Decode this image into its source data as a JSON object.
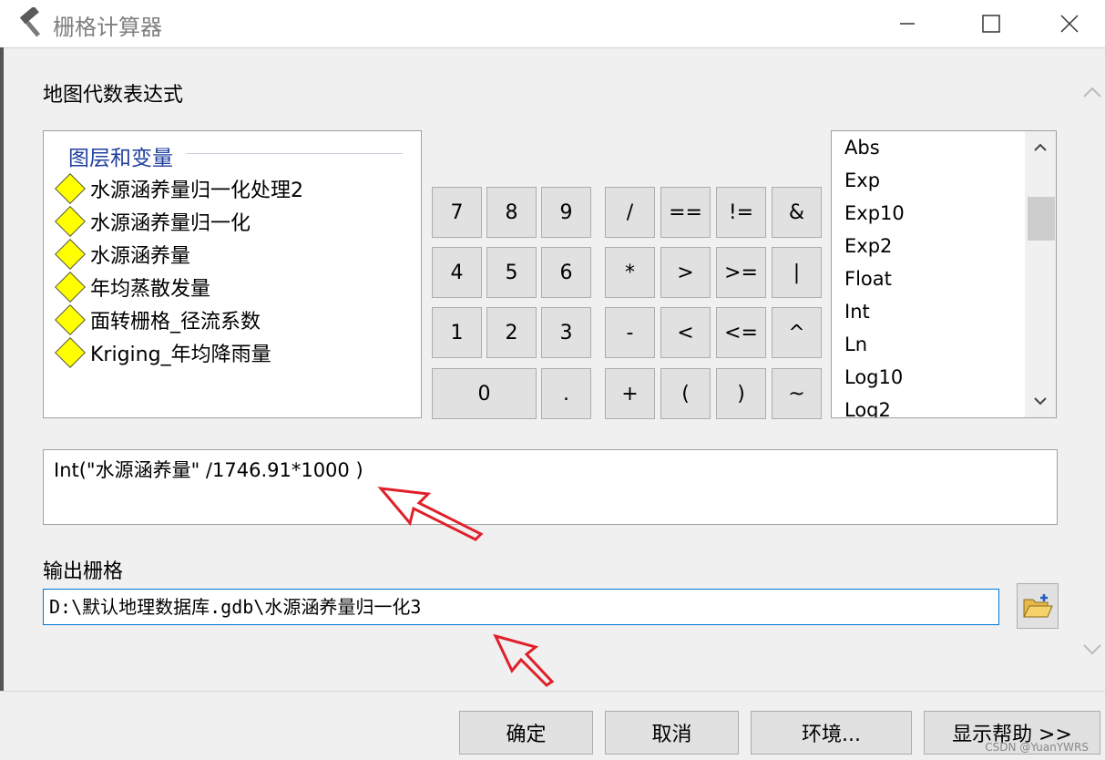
{
  "window": {
    "title": "栅格计算器",
    "minimize": "—",
    "maximize": "☐",
    "close": "✕"
  },
  "labels": {
    "map_algebra": "地图代数表达式",
    "output_raster": "输出栅格"
  },
  "layers": {
    "header": "图层和变量",
    "items": [
      "水源涵养量归一化处理2",
      "水源涵养量归一化",
      "水源涵养量",
      "年均蒸散发量",
      "面转栅格_径流系数",
      "Kriging_年均降雨量"
    ]
  },
  "keypad": {
    "row1": [
      "7",
      "8",
      "9",
      "/",
      "==",
      "!=",
      "&"
    ],
    "row2": [
      "4",
      "5",
      "6",
      "*",
      ">",
      ">=",
      "|"
    ],
    "row3": [
      "1",
      "2",
      "3",
      "-",
      "<",
      "<=",
      "^"
    ],
    "row4": [
      "0",
      ".",
      "+",
      "(",
      ")",
      "~"
    ]
  },
  "functions": [
    "Abs",
    "Exp",
    "Exp10",
    "Exp2",
    "Float",
    "Int",
    "Ln",
    "Log10",
    "Log2"
  ],
  "expression": "Int(\"水源涵养量\" /1746.91*1000 )",
  "output_path": "D:\\默认地理数据库.gdb\\水源涵养量归一化3",
  "buttons": {
    "ok": "确定",
    "cancel": "取消",
    "env": "环境...",
    "help": "显示帮助 >>"
  },
  "watermark": "CSDN @YuanYWRS",
  "colors": {
    "arrow": "#e0202a",
    "layer_header": "#1f3f9f",
    "diamond": "#ffff00",
    "focus_border": "#0078d7"
  }
}
